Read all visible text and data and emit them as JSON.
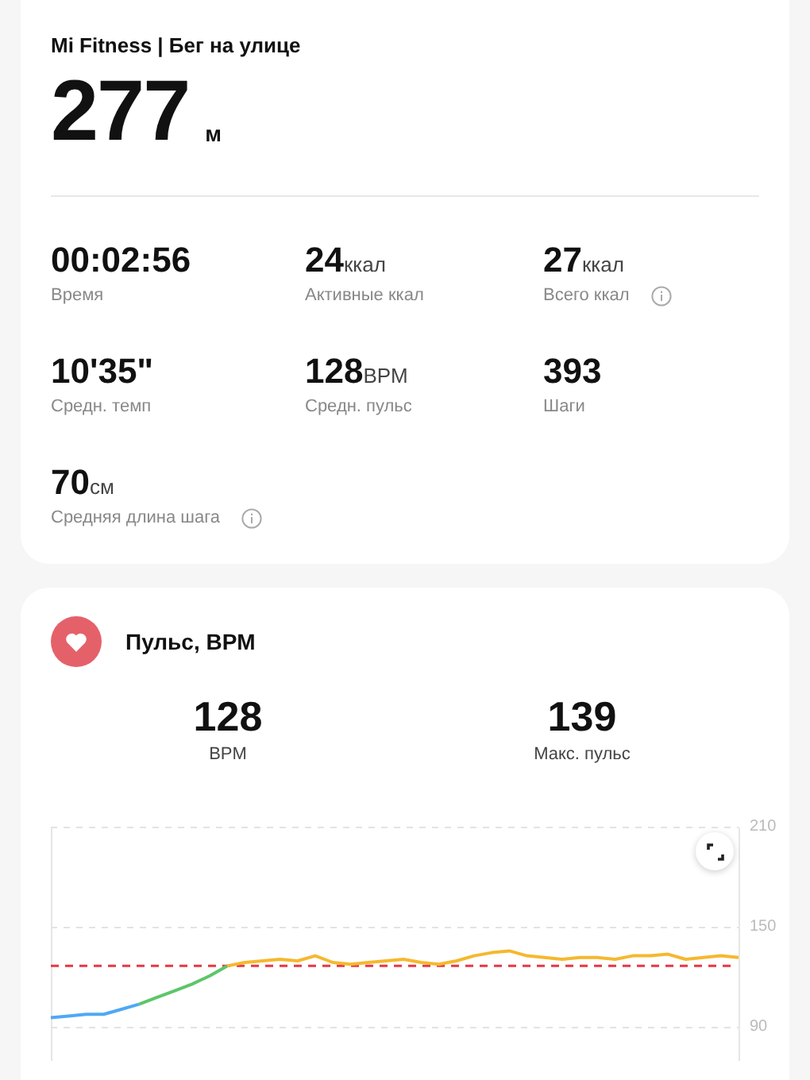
{
  "summary": {
    "title": "Mi Fitness | Бег на улице",
    "distance": "277",
    "distance_unit": "м",
    "stats": [
      {
        "value": "00:02:56",
        "label": "Время",
        "info": false
      },
      {
        "value": "24",
        "unit": "ккал",
        "label": "Активные ккал",
        "info": false
      },
      {
        "value": "27",
        "unit": "ккал",
        "label": "Всего ккал",
        "info": true
      },
      {
        "value": "10'35\"",
        "label": "Средн. темп",
        "info": false
      },
      {
        "value": "128",
        "unit": "BPM",
        "label": "Средн. пульс",
        "info": false
      },
      {
        "value": "393",
        "label": "Шаги",
        "info": false
      },
      {
        "value": "70",
        "unit": "см",
        "label": "Средняя длина шага",
        "info": true
      }
    ]
  },
  "heart_rate": {
    "title": "Пульс, BPM",
    "stats": [
      {
        "value": "128",
        "label": "BPM"
      },
      {
        "value": "139",
        "label": "Макс. пульс"
      }
    ],
    "chart_data": {
      "type": "line",
      "ylim": [
        70,
        210
      ],
      "yticks": [
        90,
        150,
        210
      ],
      "series": [
        {
          "color": "#4ea8f5",
          "values": [
            96,
            97,
            98,
            98,
            101,
            104,
            null,
            null,
            null,
            null,
            null,
            null,
            null,
            null,
            null,
            null,
            null,
            null,
            null,
            null,
            null,
            null,
            null,
            null,
            null,
            null,
            null,
            null,
            null,
            null,
            null,
            null,
            null,
            null,
            null,
            null,
            null,
            null,
            null,
            null
          ]
        },
        {
          "color": "#5cc66a",
          "values": [
            null,
            null,
            null,
            null,
            null,
            104,
            108,
            112,
            116,
            121,
            127,
            null,
            null,
            null,
            null,
            null,
            null,
            null,
            null,
            null,
            null,
            null,
            null,
            null,
            null,
            null,
            null,
            null,
            null,
            null,
            null,
            null,
            null,
            null,
            null,
            null,
            null,
            null,
            null,
            null
          ]
        },
        {
          "color": "#f5b82e",
          "values": [
            null,
            null,
            null,
            null,
            null,
            null,
            null,
            null,
            null,
            null,
            127,
            129,
            130,
            131,
            130,
            133,
            129,
            128,
            129,
            130,
            131,
            129,
            128,
            130,
            133,
            135,
            136,
            133,
            132,
            131,
            132,
            132,
            131,
            133,
            133,
            134,
            131,
            132,
            133,
            132
          ]
        }
      ],
      "ref_lines": [
        {
          "axis": "y",
          "value": 127,
          "color": "#e53945"
        }
      ]
    }
  }
}
